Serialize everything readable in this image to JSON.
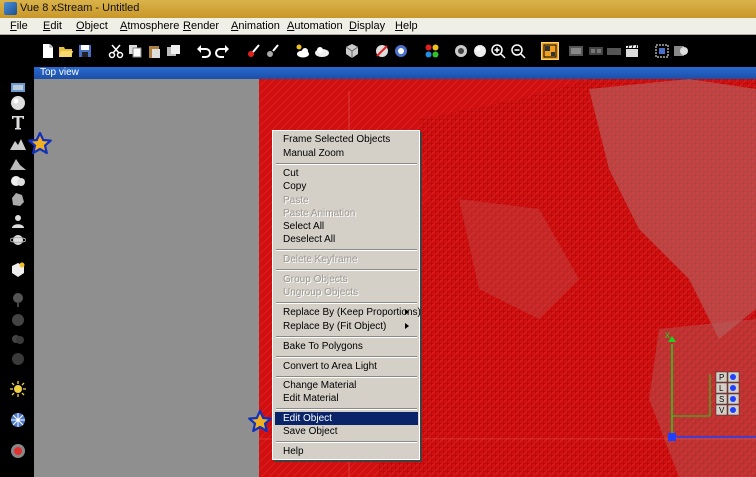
{
  "window": {
    "title": "Vue 8 xStream - Untitled"
  },
  "menu": [
    {
      "label": "File",
      "key": "F",
      "rest": "ile"
    },
    {
      "label": "Edit",
      "key": "E",
      "rest": "dit"
    },
    {
      "label": "Object",
      "key": "O",
      "rest": "bject"
    },
    {
      "label": "Atmosphere",
      "key": "A",
      "rest": "tmosphere"
    },
    {
      "label": "Render",
      "key": "R",
      "rest": "ender"
    },
    {
      "label": "Animation",
      "key": "A",
      "rest": "nimation"
    },
    {
      "label": "Automation",
      "key": "A",
      "rest": "utomation"
    },
    {
      "label": "Display",
      "key": "D",
      "rest": "isplay"
    },
    {
      "label": "Help",
      "key": "H",
      "rest": "elp"
    }
  ],
  "viewport": {
    "title": "Top view"
  },
  "context_menu": {
    "items": [
      {
        "label": "Frame Selected Objects",
        "enabled": true
      },
      {
        "label": "Manual Zoom",
        "enabled": true
      },
      {
        "label": "Cut",
        "enabled": true
      },
      {
        "label": "Copy",
        "enabled": true
      },
      {
        "label": "Paste",
        "enabled": false
      },
      {
        "label": "Paste Animation",
        "enabled": false
      },
      {
        "label": "Select All",
        "enabled": true
      },
      {
        "label": "Deselect All",
        "enabled": true
      },
      {
        "label": "Delete Keyframe",
        "enabled": false
      },
      {
        "label": "Group Objects",
        "enabled": false
      },
      {
        "label": "Ungroup Objects",
        "enabled": false
      },
      {
        "label": "Replace By (Keep Proportions)",
        "enabled": true,
        "submenu": true
      },
      {
        "label": "Replace By (Fit Object)",
        "enabled": true,
        "submenu": true
      },
      {
        "label": "Bake To Polygons",
        "enabled": true
      },
      {
        "label": "Convert to Area Light",
        "enabled": true
      },
      {
        "label": "Change Material",
        "enabled": true
      },
      {
        "label": "Edit Material",
        "enabled": true
      },
      {
        "label": "Edit Object",
        "enabled": true,
        "highlighted": true
      },
      {
        "label": "Save Object",
        "enabled": true
      },
      {
        "label": "Help",
        "enabled": true
      }
    ]
  },
  "gizmo_labels": {
    "p": "P",
    "l": "L",
    "s": "S",
    "v": "V"
  },
  "colors": {
    "viewport_red": "#d01010",
    "highlight": "#0a246a",
    "star": "#f0b020"
  }
}
